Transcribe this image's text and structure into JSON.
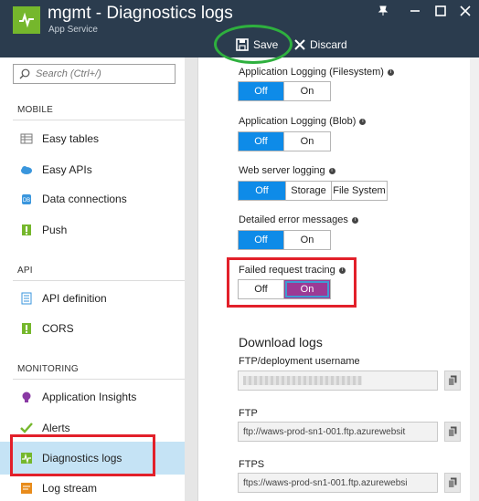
{
  "window": {
    "title": "mgmt - Diagnostics logs",
    "subtitle": "App Service"
  },
  "toolbar": {
    "save_label": "Save",
    "discard_label": "Discard"
  },
  "sidebar": {
    "search_placeholder": "Search (Ctrl+/)",
    "sections": [
      {
        "title": "MOBILE",
        "items": [
          {
            "label": "Easy tables",
            "icon": "table-icon"
          },
          {
            "label": "Easy APIs",
            "icon": "cloud-api-icon"
          },
          {
            "label": "Data connections",
            "icon": "database-icon"
          },
          {
            "label": "Push",
            "icon": "push-icon"
          }
        ]
      },
      {
        "title": "API",
        "items": [
          {
            "label": "API definition",
            "icon": "api-definition-icon"
          },
          {
            "label": "CORS",
            "icon": "cors-icon"
          }
        ]
      },
      {
        "title": "MONITORING",
        "items": [
          {
            "label": "Application Insights",
            "icon": "lightbulb-icon"
          },
          {
            "label": "Alerts",
            "icon": "checkmark-icon"
          },
          {
            "label": "Diagnostics logs",
            "icon": "diagnostics-icon",
            "active": true
          },
          {
            "label": "Log stream",
            "icon": "log-stream-icon"
          }
        ]
      }
    ]
  },
  "settings": {
    "app_logging_fs": {
      "label": "Application Logging (Filesystem)",
      "options": [
        "Off",
        "On"
      ],
      "selected": "Off"
    },
    "app_logging_blob": {
      "label": "Application Logging (Blob)",
      "options": [
        "Off",
        "On"
      ],
      "selected": "Off"
    },
    "web_server_logging": {
      "label": "Web server logging",
      "options": [
        "Off",
        "Storage",
        "File System"
      ],
      "selected": "Off"
    },
    "detailed_errors": {
      "label": "Detailed error messages",
      "options": [
        "Off",
        "On"
      ],
      "selected": "Off"
    },
    "failed_request_tracing": {
      "label": "Failed request tracing",
      "options": [
        "Off",
        "On"
      ],
      "selected": "On"
    }
  },
  "download_logs": {
    "title": "Download logs",
    "ftp_username_label": "FTP/deployment username",
    "ftp_label": "FTP",
    "ftp_value": "ftp://waws-prod-sn1-001.ftp.azurewebsit",
    "ftps_label": "FTPS",
    "ftps_value": "ftps://waws-prod-sn1-001.ftp.azurewebsi"
  },
  "colors": {
    "titlebar": "#2b3c4e",
    "accent_blue": "#0e8be8",
    "selected_purple": "#9c3a95",
    "highlight_red": "#e2202a",
    "highlight_green": "#2eb03e",
    "active_item": "#c5e3f5"
  }
}
